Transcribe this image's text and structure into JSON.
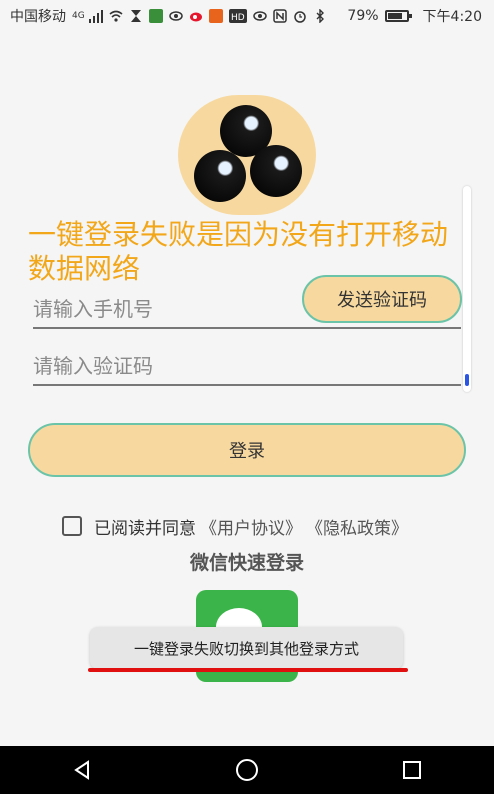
{
  "status_bar": {
    "carrier": "中国移动",
    "network": "4G",
    "battery": "79%",
    "battery_fraction": 0.79,
    "time": "下午4:20"
  },
  "main": {
    "error_message": "一键登录失败是因为没有打开移动数据网络",
    "phone_placeholder": "请输入手机号",
    "code_placeholder": "请输入验证码",
    "send_code_label": "发送验证码",
    "login_label": "登录",
    "agree_text": "已阅读并同意",
    "user_agreement": "《用户协议》",
    "privacy_policy": "《隐私政策》",
    "wechat_title": "微信快速登录"
  },
  "toast": {
    "message": "一键登录失败切换到其他登录方式"
  },
  "colors": {
    "accent_fill": "#f7d9a0",
    "accent_border": "#6cc4a8",
    "error_text": "#f2a71b",
    "wechat_green": "#3bb54a",
    "highlight_red": "#e01010"
  }
}
